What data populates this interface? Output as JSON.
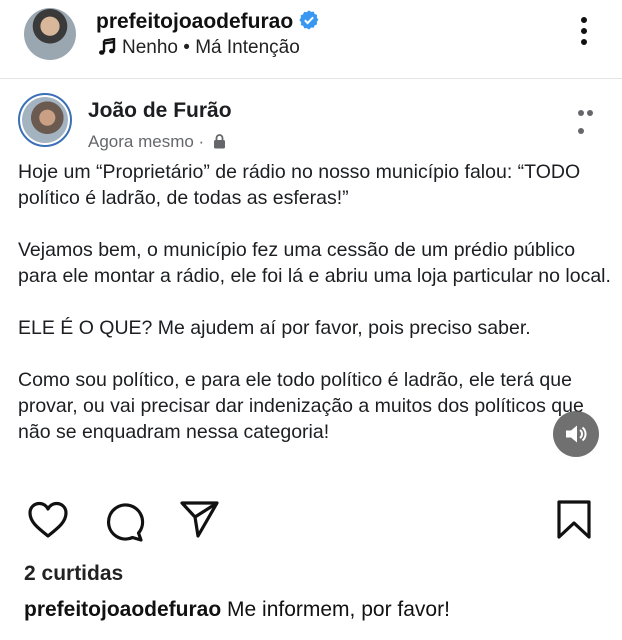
{
  "header": {
    "username": "prefeitojoaodefurao",
    "music_artist": "Nenho",
    "music_separator": " • ",
    "music_title": "Má Intenção",
    "icons": [
      "avatar",
      "verified-badge-icon",
      "music-note-icon",
      "more-vertical-icon"
    ]
  },
  "post": {
    "author": "João de Furão",
    "time": "Agora mesmo",
    "meta_separator": " · ",
    "privacy_icon": "lock-icon",
    "paragraphs": [
      "Hoje um “Proprietário” de rádio no nosso município falou: “TODO político é ladrão, de todas as esferas!”",
      "Vejamos bem, o município fez uma cessão de um prédio público para ele montar a rádio, ele foi lá e abriu uma loja particular no local.",
      "ELE É O QUE? Me ajudem aí por favor, pois preciso saber.",
      "Como sou político, e para ele todo político é ladrão, ele terá que provar, ou vai precisar dar indenização a muitos dos políticos que não se enquadram nessa categoria!"
    ]
  },
  "footer": {
    "likes": "2 curtidas",
    "caption_user": "prefeitojoaodefurao",
    "caption_text": " Me informem, por favor!"
  },
  "colors": {
    "verified": "#3897f0",
    "avatar_ring": "#3b6fb6",
    "muted": "#65676b"
  }
}
